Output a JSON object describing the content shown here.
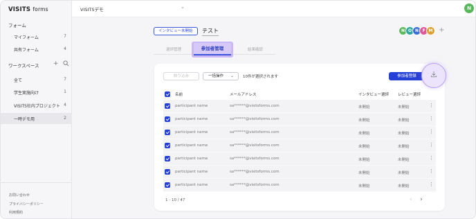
{
  "app": {
    "logo": "VISITS",
    "logo_sub": "forms"
  },
  "sidebar": {
    "form_section": "フォーム",
    "form_items": [
      {
        "label": "マイフォーム",
        "count": "7"
      },
      {
        "label": "共有フォーム",
        "count": "4"
      }
    ],
    "workspace_section": "ワークスペース",
    "workspace_items": [
      {
        "label": "全て",
        "count": "7"
      },
      {
        "label": "学生実施向け",
        "count": "1"
      },
      {
        "label": "VISITS社内プロジェクト",
        "count": "4"
      },
      {
        "label": "一時デモ用",
        "count": "2",
        "active": true
      }
    ],
    "footer_links": [
      "お問い合わせ",
      "プライバシーポリシー",
      "利用規約"
    ]
  },
  "topbar": {
    "workspace": "VISITSデモ",
    "user_initial": "N",
    "user_color": "#5cb85c"
  },
  "form": {
    "status_tag": "インタビュー未開始",
    "title": "テスト",
    "collaborators": [
      {
        "initial": "N",
        "color": "#5cb85c"
      },
      {
        "initial": "O",
        "color": "#2fa8a0"
      },
      {
        "initial": "N",
        "color": "#3b6fd8"
      },
      {
        "initial": "F",
        "color": "#e05a9a"
      },
      {
        "initial": "M",
        "color": "#e0a030"
      }
    ]
  },
  "tabs": [
    {
      "label": "選評管理"
    },
    {
      "label": "参加者管理",
      "active": true
    },
    {
      "label": "結果確認"
    }
  ],
  "toolbar": {
    "filter_label": "絞り込み",
    "bulk_label": "一括操作",
    "selected_text": "10件が選択されます",
    "register_label": "参加者登録"
  },
  "table": {
    "columns": [
      "名前",
      "メールアドレス",
      "インタビュー選評",
      "レビュー選評"
    ],
    "rows": [
      {
        "name": "participant name",
        "email": "sa******@visitsforms.com",
        "interview": "未開始",
        "review": "未開始"
      },
      {
        "name": "participant name",
        "email": "sa******@visitsforms.com",
        "interview": "未開始",
        "review": "未開始"
      },
      {
        "name": "participant name",
        "email": "sa******@visitsforms.com",
        "interview": "未開始",
        "review": "未開始"
      },
      {
        "name": "participant name",
        "email": "sa******@visitsforms.com",
        "interview": "未開始",
        "review": "未開始"
      },
      {
        "name": "participant name",
        "email": "sa******@visitsforms.com",
        "interview": "未開始",
        "review": "未開始"
      },
      {
        "name": "participant name",
        "email": "sa******@visitsforms.com",
        "interview": "未開始",
        "review": "未開始"
      },
      {
        "name": "participant name",
        "email": "sa******@visitsforms.com",
        "interview": "未開始",
        "review": "未開始"
      }
    ]
  },
  "pagination": {
    "range": "1 - 10 / 47"
  },
  "colors": {
    "accent": "#2540d6",
    "highlight": "#c9b8f4"
  }
}
